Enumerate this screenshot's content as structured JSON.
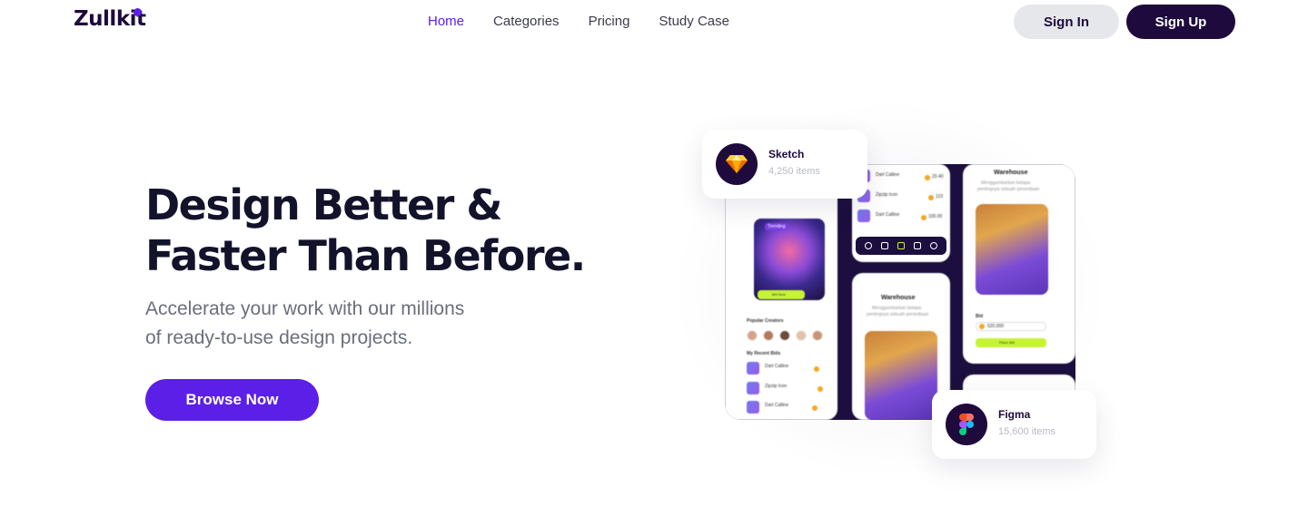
{
  "brand": {
    "logo_text": "Zullkit"
  },
  "nav": {
    "links": [
      {
        "label": "Home",
        "active": true
      },
      {
        "label": "Categories",
        "active": false
      },
      {
        "label": "Pricing",
        "active": false
      },
      {
        "label": "Study Case",
        "active": false
      }
    ],
    "sign_in_label": "Sign In",
    "sign_up_label": "Sign Up"
  },
  "hero": {
    "title_line1": "Design Better &",
    "title_line2": "Faster Than Before.",
    "subtitle_line1": "Accelerate your work with our millions",
    "subtitle_line2": "of ready-to-use design projects.",
    "cta_label": "Browse Now"
  },
  "cards": {
    "sketch": {
      "name": "Sketch",
      "count": "4,250 items",
      "icon": "sketch-diamond-icon"
    },
    "figma": {
      "name": "Figma",
      "count": "15,600 items",
      "icon": "figma-logo-icon"
    }
  },
  "mockup": {
    "trending_label": "Trending",
    "bid_now_label": "Bid Now",
    "popular_creators_label": "Popular Creators",
    "recent_bids_label": "My Recent Bids",
    "warehouse_title": "Warehouse",
    "warehouse_sub_line1": "Menggambarkan betapa",
    "warehouse_sub_line2": "pentingnya sebuah persediaan",
    "list_items": [
      {
        "name": "Dart Calline",
        "value": "20.40"
      },
      {
        "name": "Zipzip Icon",
        "value": "110"
      },
      {
        "name": "Dart Calline",
        "value": "100.00"
      }
    ],
    "bid_label": "Bid",
    "bid_value": "520,000",
    "place_bid_label": "Place Bid"
  },
  "colors": {
    "primary": "#5b1fe8",
    "dark": "#1e0a3c",
    "muted": "#6b6e7c",
    "lime": "#c6f432"
  }
}
